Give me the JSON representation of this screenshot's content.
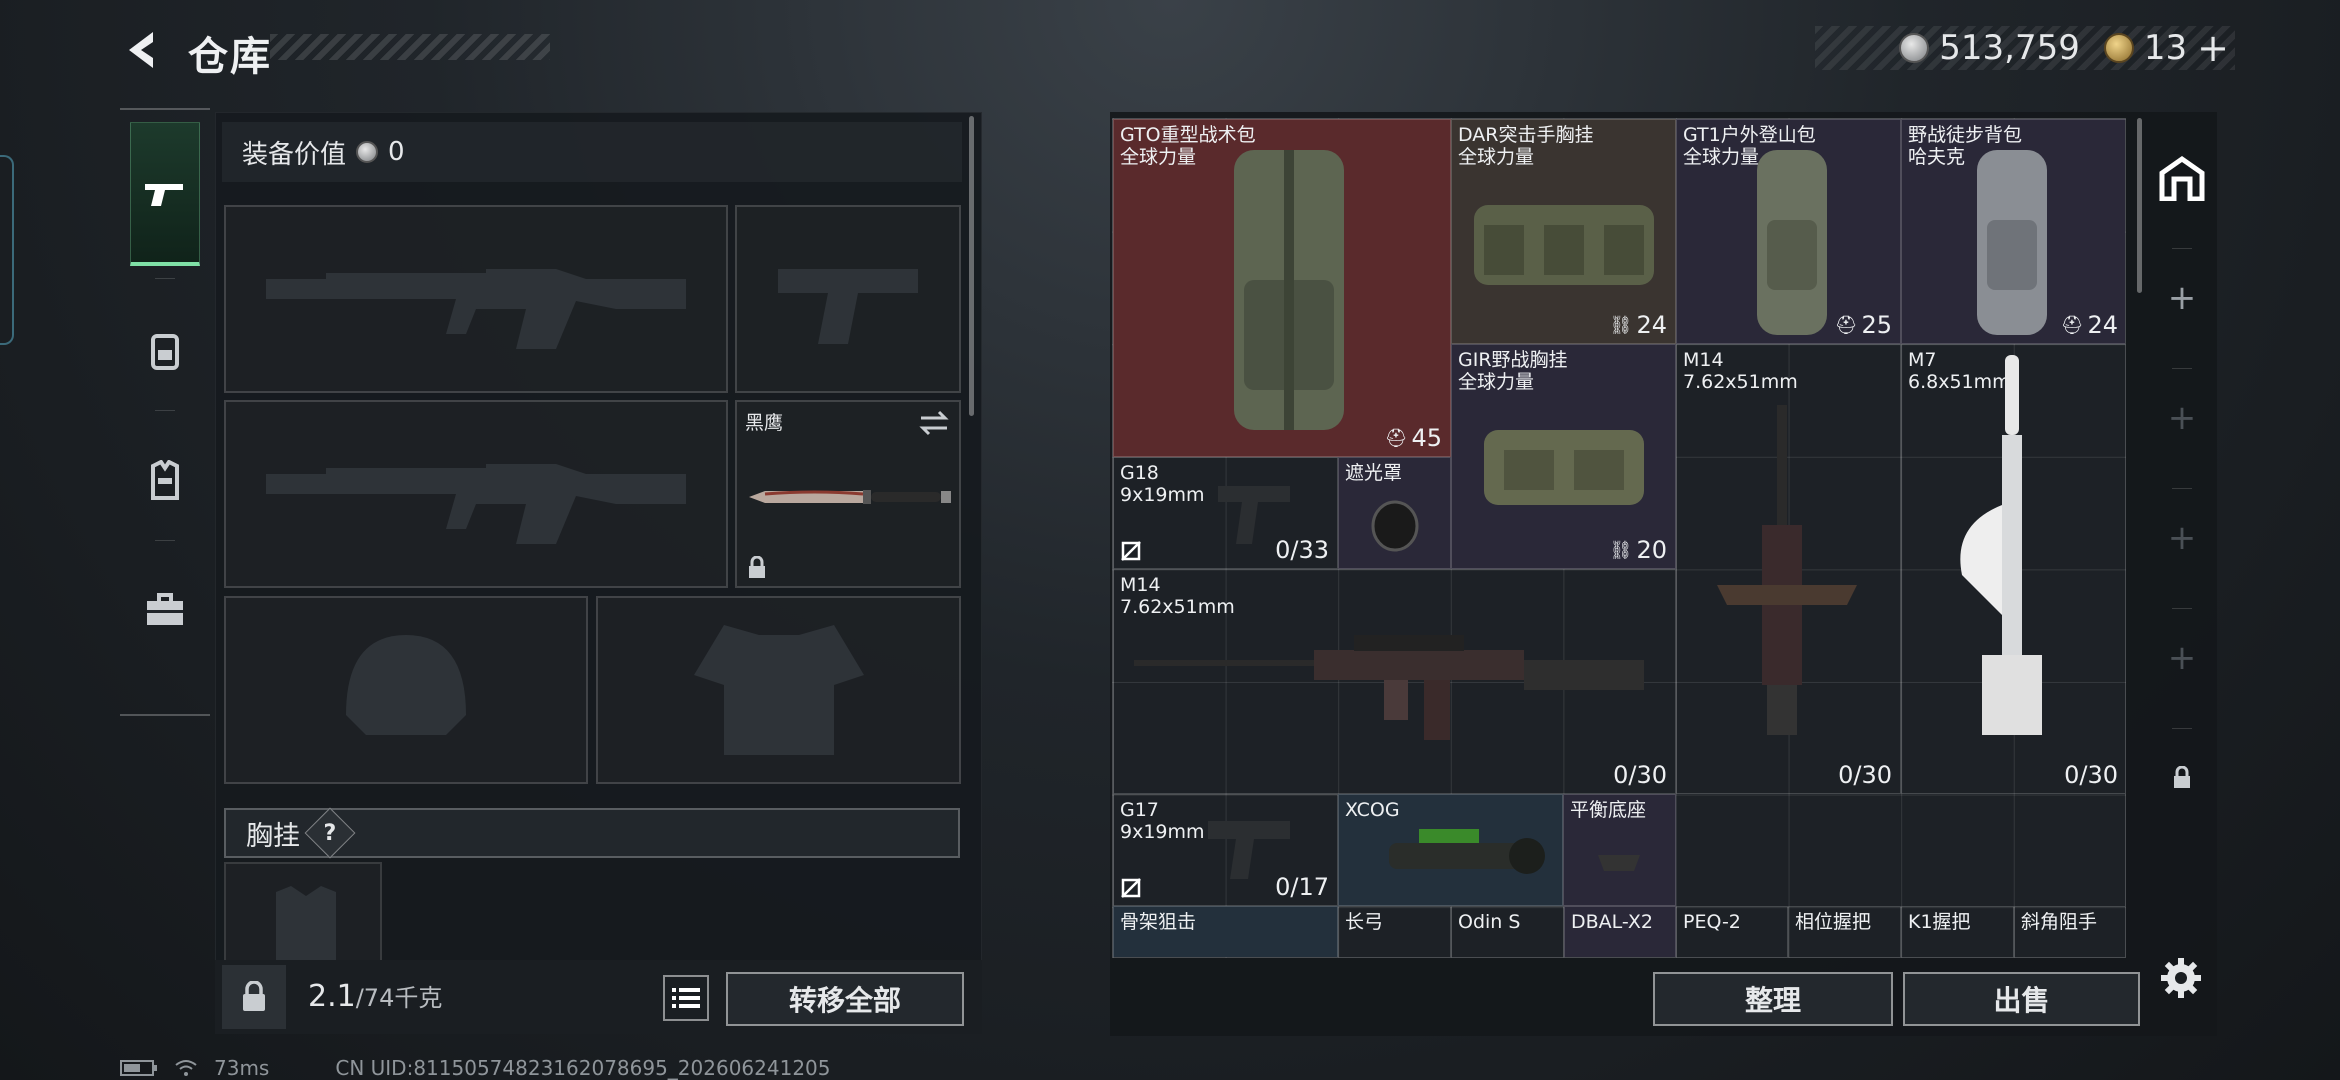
{
  "header": {
    "title": "仓库",
    "currency": {
      "coins": "513,759",
      "tokens": "13",
      "add_symbol": "+"
    }
  },
  "left_nav": {
    "items": [
      "pistol-icon",
      "backpack-icon",
      "vest-icon",
      "briefcase-icon"
    ],
    "active": 0
  },
  "loadout": {
    "equip_value_label": "装备价值",
    "equip_value": "0",
    "melee_name": "黑鹰",
    "chest_label": "胸挂",
    "chest_help": "?",
    "weight_current": "2.1",
    "weight_max": "/74千克",
    "transfer_all": "转移全部"
  },
  "stash": {
    "items": [
      {
        "name": "GTO重型战术包",
        "sub": "全球力量",
        "count": "45",
        "count_icon": "helmet-icon"
      },
      {
        "name": "DAR突击手胸挂",
        "sub": "全球力量",
        "count": "24",
        "count_icon": "vest-icon"
      },
      {
        "name": "GT1户外登山包",
        "sub": "全球力量",
        "count": "25",
        "count_icon": "helmet-icon"
      },
      {
        "name": "野战徒步背包",
        "sub": "哈夫克",
        "count": "24",
        "count_icon": "helmet-icon"
      },
      {
        "name": "GIR野战胸挂",
        "sub": "全球力量",
        "count": "20",
        "count_icon": "vest-icon"
      },
      {
        "name": "M14",
        "sub": "7.62x51mm",
        "count": "0/30"
      },
      {
        "name": "M7",
        "sub": "6.8x51mm",
        "count": "0/30"
      },
      {
        "name": "G18",
        "sub": "9x19mm",
        "count": "0/33"
      },
      {
        "name": "遮光罩",
        "sub": ""
      },
      {
        "name": "M14",
        "sub": "7.62x51mm",
        "count": "0/30"
      },
      {
        "name": "G17",
        "sub": "9x19mm",
        "count": "0/17"
      },
      {
        "name": "XCOG",
        "sub": ""
      },
      {
        "name": "平衡底座",
        "sub": ""
      },
      {
        "name": "骨架狙击",
        "sub": ""
      },
      {
        "name": "长弓",
        "sub": ""
      },
      {
        "name": "Odin S",
        "sub": ""
      },
      {
        "name": "DBAL-X2",
        "sub": ""
      },
      {
        "name": "PEQ-2",
        "sub": ""
      },
      {
        "name": "相位握把",
        "sub": ""
      },
      {
        "name": "K1握把",
        "sub": ""
      },
      {
        "name": "斜角阻手",
        "sub": ""
      }
    ],
    "sort_label": "整理",
    "sell_label": "出售"
  },
  "right_nav": {
    "add_symbol": "+"
  },
  "status": {
    "ping": "73ms",
    "uid": "CN UID:81150574823162078695_202606241205"
  },
  "colors": {
    "accent_green": "#7fe0a6",
    "rare_red": "#5a2a2c",
    "rare_purple": "#2a2838",
    "rare_blue": "#23303c"
  }
}
